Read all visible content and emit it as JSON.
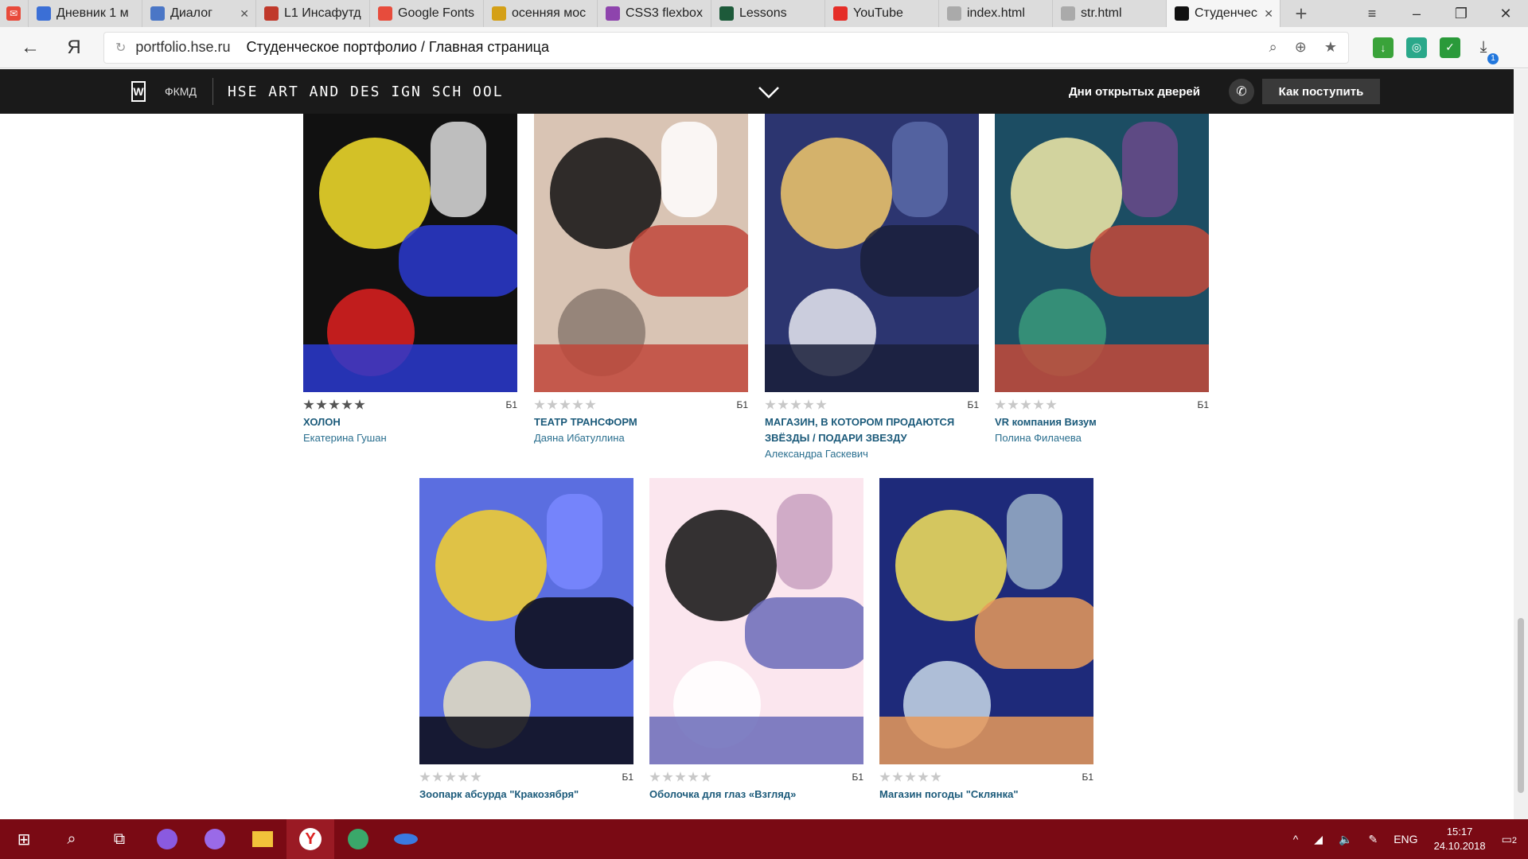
{
  "browser": {
    "tabs": [
      {
        "label": "Дневник 1 м",
        "color": "#3b6fd6"
      },
      {
        "label": "Диалог",
        "color": "#4a76c6"
      },
      {
        "label": "L1 Инсафутд",
        "color": "#c0392b"
      },
      {
        "label": "Google Fonts",
        "color": "#e74c3c"
      },
      {
        "label": "осенняя мос",
        "color": "#d4a017"
      },
      {
        "label": "CSS3 flexbox",
        "color": "#8e44ad"
      },
      {
        "label": "Lessons",
        "color": "#1d5a3a"
      },
      {
        "label": "YouTube",
        "color": "#e52d27"
      },
      {
        "label": "index.html",
        "color": "#aaaaaa"
      },
      {
        "label": "str.html",
        "color": "#aaaaaa"
      },
      {
        "label": "Студенческ",
        "color": "#111111"
      }
    ],
    "url_host": "portfolio.hse.ru",
    "page_title": "Студенческое портфолио / Главная страница",
    "back_label": "←",
    "ya_label": "Я",
    "downloads_count": "1"
  },
  "site": {
    "section": "ФКМД",
    "brand": "HSE ART AND DES IGN SCH OOL",
    "open_days": "Дни открытых дверей",
    "apply": "Как поступить"
  },
  "cards": [
    {
      "title": "ХОЛОН",
      "author": "Екатерина Гушан",
      "course": "Б1",
      "rating": 5,
      "palette": [
        "#111",
        "#f6e12b",
        "#2a3ad0",
        "#e02020",
        "#ddd"
      ]
    },
    {
      "title": "ТЕАТР ТРАНСФОРМ",
      "author": "Даяна Ибатуллина",
      "course": "Б1",
      "rating": 0,
      "palette": [
        "#d9c4b4",
        "#111",
        "#c0463a",
        "#8a7a70",
        "#fff"
      ]
    },
    {
      "title": "МАГАЗИН, В КОТОРОМ ПРОДАЮТСЯ ЗВЁЗДЫ / ПОДАРИ ЗВЕЗДУ",
      "author": "Александра Гаскевич",
      "course": "Б1",
      "rating": 0,
      "palette": [
        "#2c3570",
        "#f2c86a",
        "#1a1f3a",
        "#e8e8f0",
        "#5a6aa8"
      ]
    },
    {
      "title": "VR компания Визум",
      "author": "Полина Филачева",
      "course": "Б1",
      "rating": 0,
      "palette": [
        "#1c4d63",
        "#f2eba8",
        "#c44a3a",
        "#3a9a7a",
        "#6a4a8a"
      ]
    },
    {
      "title": "Зоопарк абсурда \"Кракозября\"",
      "author": "",
      "course": "Б1",
      "rating": 0,
      "palette": [
        "#5b6ee0",
        "#f7d12a",
        "#0a0a14",
        "#e8e0c0",
        "#7a88ff"
      ]
    },
    {
      "title": "Оболочка для глаз «Взгляд»",
      "author": "",
      "course": "Б1",
      "rating": 0,
      "palette": [
        "#fbe6ee",
        "#111",
        "#6a6ab8",
        "#ffffff",
        "#c8a0c0"
      ]
    },
    {
      "title": "Магазин погоды \"Склянка\"",
      "author": "",
      "course": "Б1",
      "rating": 0,
      "palette": [
        "#1e2a7a",
        "#f5e25a",
        "#e89a5a",
        "#c8d8e8",
        "#9ab0c8"
      ]
    }
  ],
  "taskbar": {
    "lang": "ENG",
    "time": "15:17",
    "date": "24.10.2018",
    "notifications": "2"
  }
}
